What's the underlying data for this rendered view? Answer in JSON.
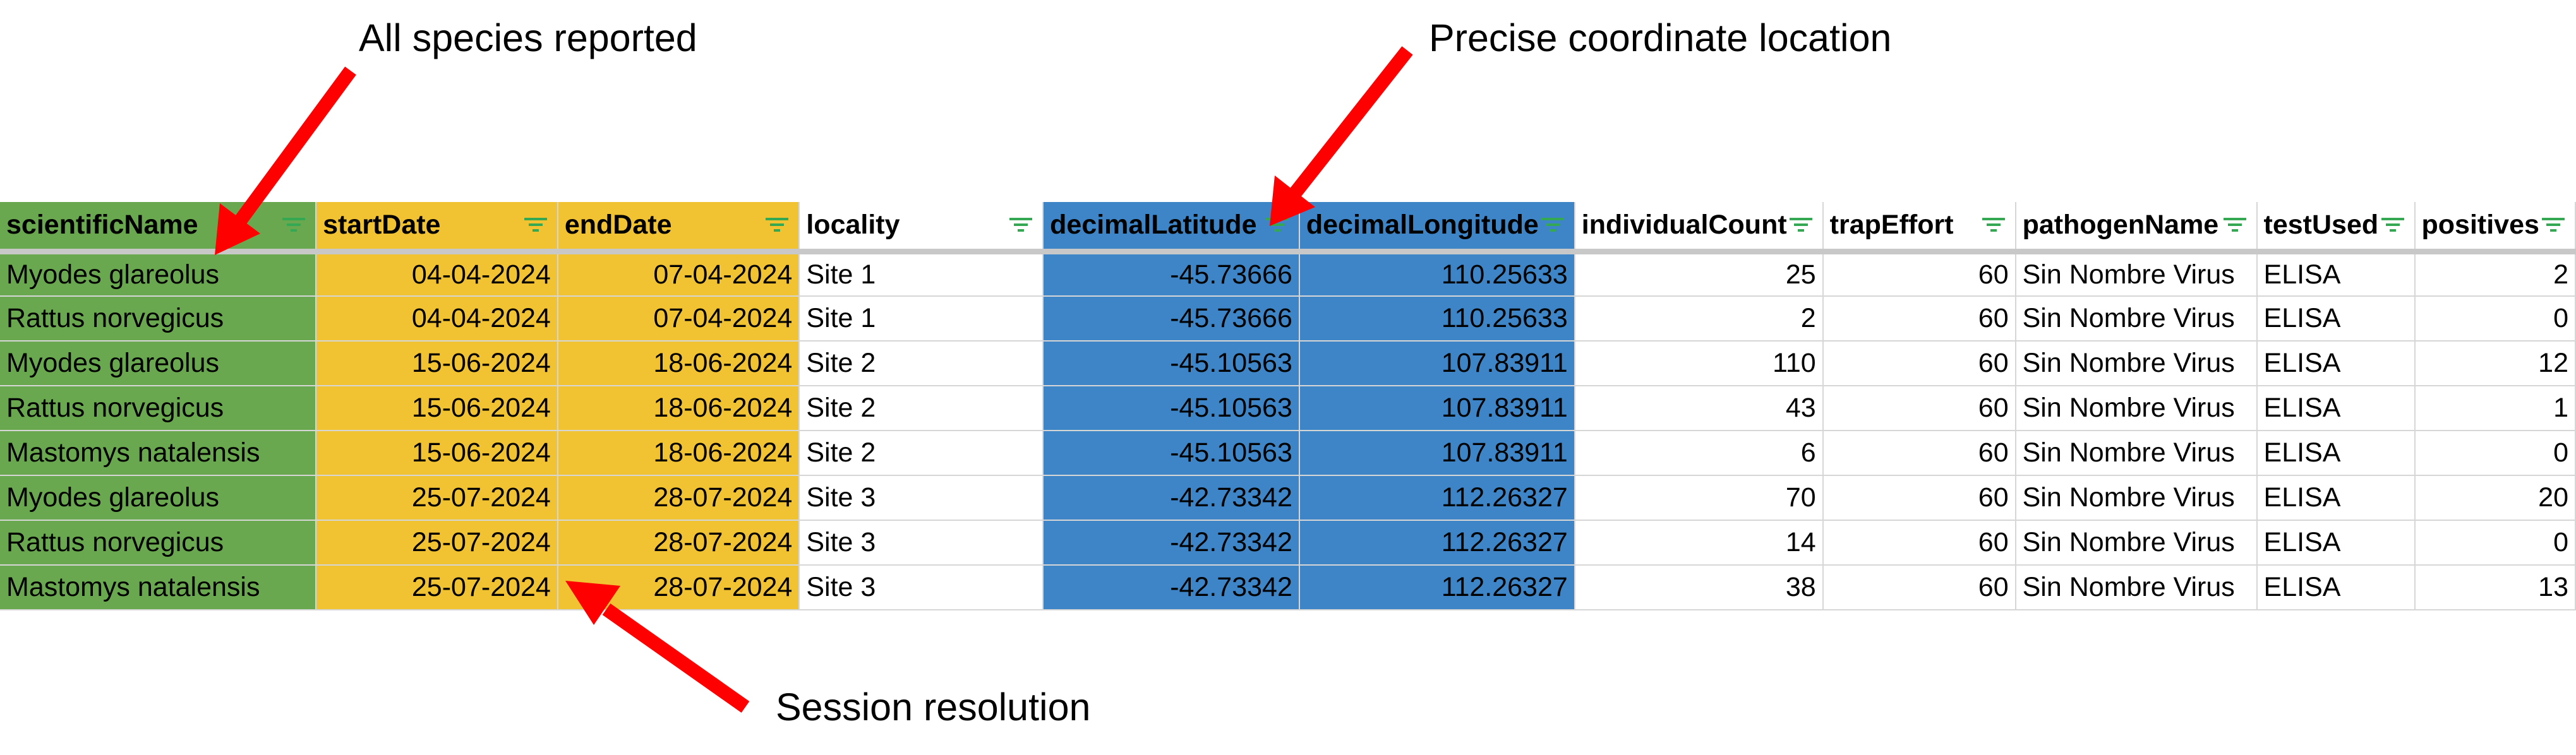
{
  "annotations": {
    "species": "All species reported",
    "coordinates": "Precise coordinate location",
    "session": "Session resolution"
  },
  "colors": {
    "green": "#6aa84f",
    "yellow": "#f1c232",
    "blue": "#3d85c6",
    "arrow": "#ff0000",
    "filter_icon": "#34a853"
  },
  "table": {
    "headers": [
      "scientificName",
      "startDate",
      "endDate",
      "locality",
      "decimalLatitude",
      "decimalLongitude",
      "individualCount",
      "trapEffort",
      "pathogenName",
      "testUsed",
      "positives"
    ],
    "rows": [
      [
        "Myodes glareolus",
        "04-04-2024",
        "07-04-2024",
        "Site 1",
        "-45.73666",
        "110.25633",
        "25",
        "60",
        "Sin Nombre Virus",
        "ELISA",
        "2"
      ],
      [
        "Rattus norvegicus",
        "04-04-2024",
        "07-04-2024",
        "Site 1",
        "-45.73666",
        "110.25633",
        "2",
        "60",
        "Sin Nombre Virus",
        "ELISA",
        "0"
      ],
      [
        "Myodes glareolus",
        "15-06-2024",
        "18-06-2024",
        "Site 2",
        "-45.10563",
        "107.83911",
        "110",
        "60",
        "Sin Nombre Virus",
        "ELISA",
        "12"
      ],
      [
        "Rattus norvegicus",
        "15-06-2024",
        "18-06-2024",
        "Site 2",
        "-45.10563",
        "107.83911",
        "43",
        "60",
        "Sin Nombre Virus",
        "ELISA",
        "1"
      ],
      [
        "Mastomys natalensis",
        "15-06-2024",
        "18-06-2024",
        "Site 2",
        "-45.10563",
        "107.83911",
        "6",
        "60",
        "Sin Nombre Virus",
        "ELISA",
        "0"
      ],
      [
        "Myodes glareolus",
        "25-07-2024",
        "28-07-2024",
        "Site 3",
        "-42.73342",
        "112.26327",
        "70",
        "60",
        "Sin Nombre Virus",
        "ELISA",
        "20"
      ],
      [
        "Rattus norvegicus",
        "25-07-2024",
        "28-07-2024",
        "Site 3",
        "-42.73342",
        "112.26327",
        "14",
        "60",
        "Sin Nombre Virus",
        "ELISA",
        "0"
      ],
      [
        "Mastomys natalensis",
        "25-07-2024",
        "28-07-2024",
        "Site 3",
        "-42.73342",
        "112.26327",
        "38",
        "60",
        "Sin Nombre Virus",
        "ELISA",
        "13"
      ]
    ]
  }
}
